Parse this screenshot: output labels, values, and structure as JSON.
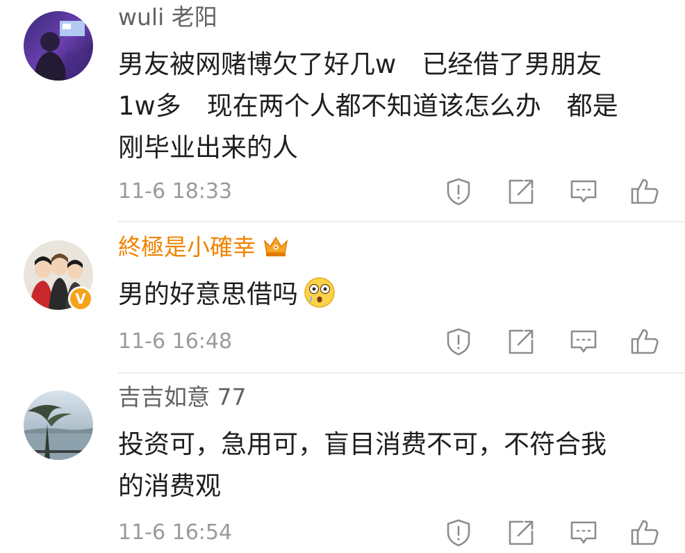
{
  "comments": [
    {
      "user": "wuli 老阳",
      "text_lines": [
        "男友被网赌博欠了好几w　已经借了男朋友",
        "1w多　现在两个人都不知道该怎么办　都是",
        "刚毕业出来的人"
      ],
      "time": "11-6 18:33",
      "avatar_icon": "user-avatar-concert",
      "vip": false,
      "verified": false
    },
    {
      "user": "終極是小確幸",
      "text_lines": [
        "男的好意思借吗"
      ],
      "time": "11-6 16:48",
      "avatar_icon": "user-avatar-group-photo",
      "vip": true,
      "verified": true,
      "verified_mark": "V",
      "emoji": "flushed-face-emoji"
    },
    {
      "user": "吉吉如意 77",
      "text_lines": [
        "投资可，急用可，盲目消费不可，不符合我",
        "的消费观"
      ],
      "time": "11-6 16:54",
      "avatar_icon": "user-avatar-lake-tree",
      "vip": false,
      "verified": false
    }
  ],
  "actions": [
    "report-icon",
    "repost-icon",
    "reply-icon",
    "like-icon"
  ],
  "colors": {
    "username": "#626262",
    "vip_username": "#f08300",
    "text": "#1f1f1f",
    "meta": "#9a9a9a",
    "icon": "#8c8c8c",
    "divider": "#ececec",
    "badge": "#f6a21a"
  }
}
